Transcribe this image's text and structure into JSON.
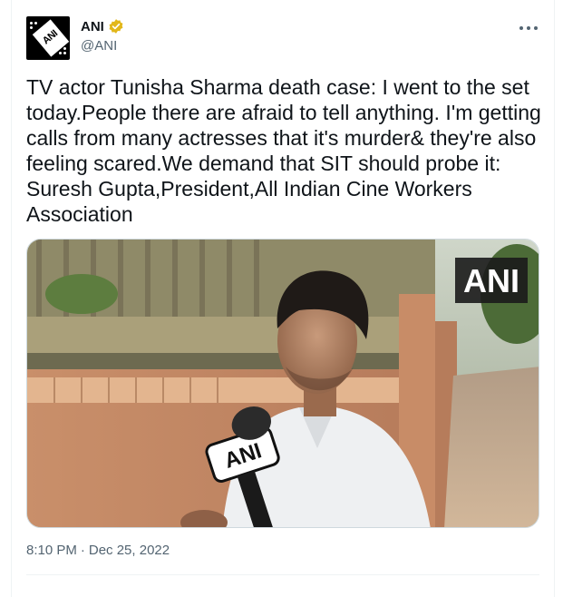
{
  "tweet": {
    "author_name": "ANI",
    "author_handle": "@ANI",
    "avatar_text": "ANI",
    "text": "TV actor Tunisha Sharma death case: I went to the set today.People there are afraid to tell anything. I'm getting calls from many actresses that it's murder& they're also feeling scared.We demand that SIT should probe it: Suresh Gupta,President,All Indian Cine Workers Association",
    "media_watermark": "ANI",
    "mic_label": "ANI",
    "time": "8:10 PM",
    "separator": "·",
    "date": "Dec 25, 2022"
  },
  "colors": {
    "accent": "#1d9bf0",
    "verified_gold": "#e2b719",
    "muted_text": "#536471"
  },
  "icons": {
    "verified": "verified-badge-icon",
    "more": "more-options-icon"
  }
}
